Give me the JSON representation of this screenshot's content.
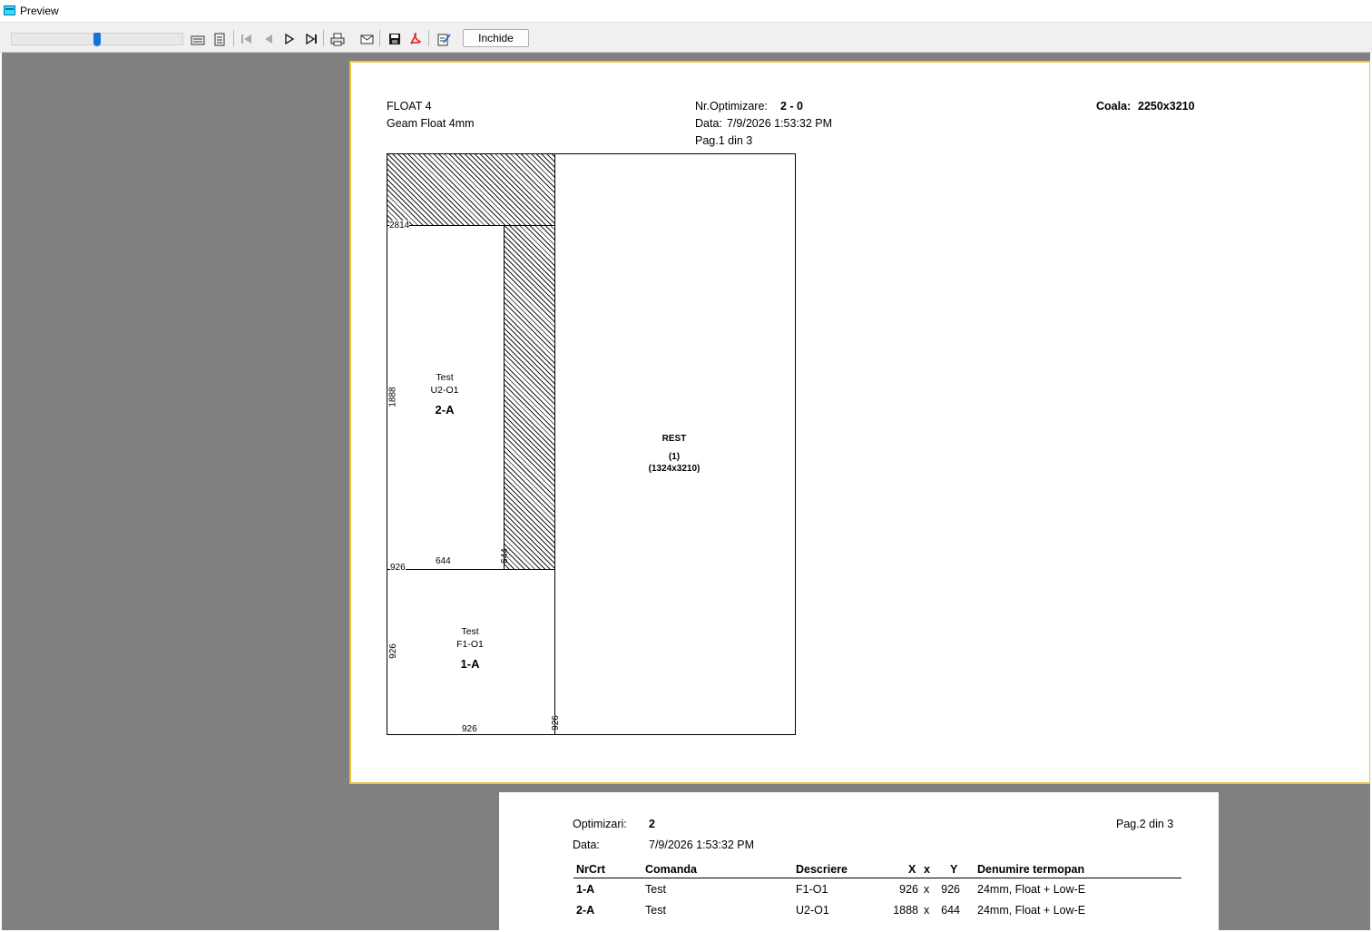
{
  "window": {
    "title": "Preview",
    "icon": "preview-app-icon"
  },
  "toolbar": {
    "zoom_level": 0.5,
    "icons": [
      "page-width-icon",
      "whole-page-icon",
      "first-page-icon",
      "previous-page-icon",
      "next-page-icon",
      "last-page-icon",
      "print-icon",
      "email-icon",
      "save-icon",
      "pdf-icon",
      "edit-icon"
    ],
    "close_label": "Inchide"
  },
  "page1": {
    "material_code": "FLOAT 4",
    "material_desc": "Geam Float 4mm",
    "opt_label": "Nr.Optimizare:",
    "opt_value": "2 - 0",
    "date_label": "Data:",
    "date_value": "7/9/2026 1:53:32 PM",
    "page_label": "Pag.1 din 3",
    "sheet_label": "Coala:",
    "sheet_value": "2250x3210",
    "layout": {
      "dim_2814": "2814",
      "dim_1888": "1888",
      "dim_644_h": "644",
      "dim_644_v": "644",
      "dim_926_left": "926",
      "dim_926_v": "926",
      "dim_926_bottom": "926",
      "dim_926_right_v": "926",
      "piece_2": {
        "order": "Test",
        "desc": "U2-O1",
        "code": "2-A"
      },
      "piece_1": {
        "order": "Test",
        "desc": "F1-O1",
        "code": "1-A"
      },
      "rest": {
        "label": "REST",
        "count": "(1)",
        "size": "(1324x3210)"
      }
    }
  },
  "page2": {
    "opt_label": "Optimizari:",
    "opt_value": "2",
    "date_label": "Data:",
    "date_value": "7/9/2026 1:53:32 PM",
    "page_label": "Pag.2 din 3",
    "columns": {
      "nrcrt": "NrCrt",
      "comanda": "Comanda",
      "descriere": "Descriere",
      "x": "X",
      "xsep": "x",
      "y": "Y",
      "denumire": "Denumire termopan"
    },
    "rows": [
      {
        "nrcrt": "1-A",
        "comanda": "Test",
        "descriere": "F1-O1",
        "x": "926",
        "sep": "x",
        "y": "926",
        "denumire": "24mm, Float + Low-E"
      },
      {
        "nrcrt": "2-A",
        "comanda": "Test",
        "descriere": "U2-O1",
        "x": "1888",
        "sep": "x",
        "y": "644",
        "denumire": "24mm, Float + Low-E"
      }
    ]
  }
}
